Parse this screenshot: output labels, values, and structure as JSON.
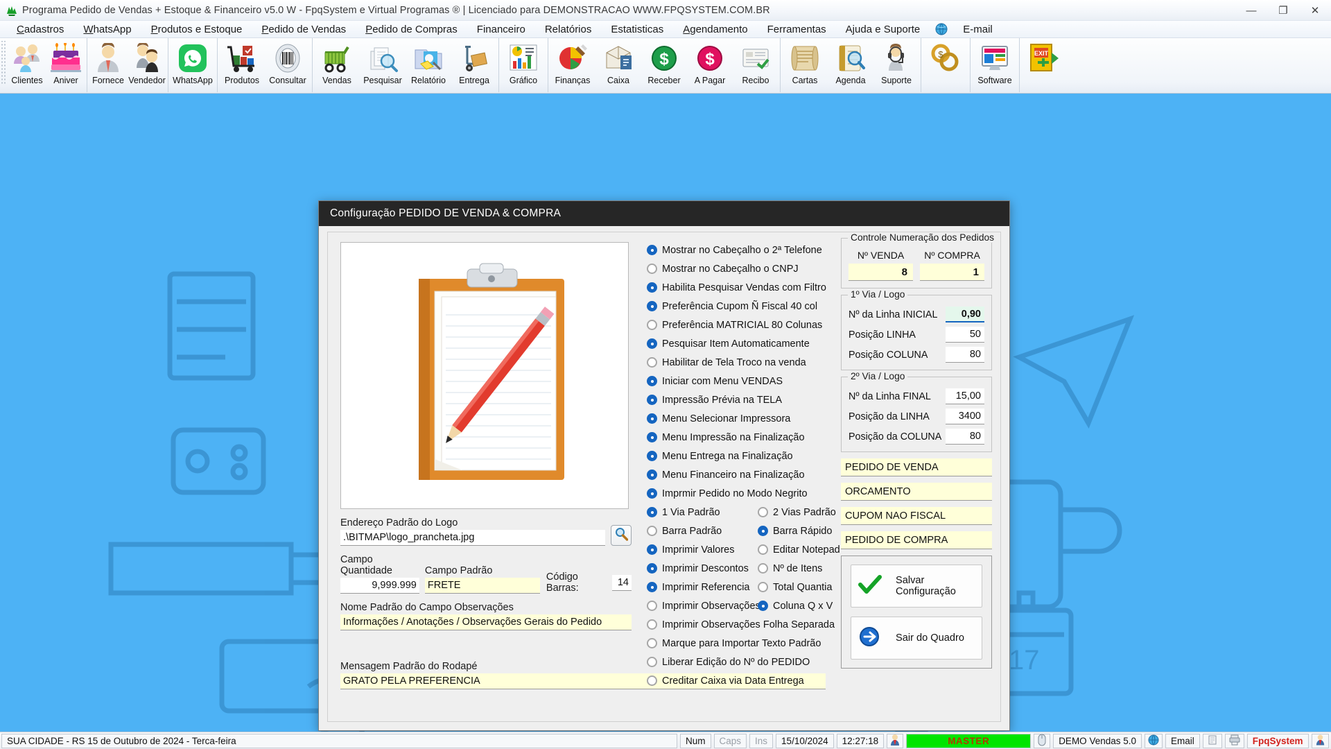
{
  "window": {
    "title": "Programa Pedido de Vendas + Estoque & Financeiro v5.0 W - FpqSystem e Virtual Programas ® | Licenciado para  DEMONSTRACAO WWW.FPQSYSTEM.COM.BR",
    "minimize": "—",
    "maximize": "❐",
    "close": "✕"
  },
  "menubar": {
    "items": [
      {
        "label": "Cadastros"
      },
      {
        "label": "WhatsApp"
      },
      {
        "label": "Produtos e Estoque"
      },
      {
        "label": "Pedido de Vendas"
      },
      {
        "label": "Pedido de Compras"
      },
      {
        "label": "Financeiro"
      },
      {
        "label": "Relatórios"
      },
      {
        "label": "Estatisticas"
      },
      {
        "label": "Agendamento"
      },
      {
        "label": "Ferramentas"
      },
      {
        "label": "Ajuda e Suporte"
      },
      {
        "label": "E-mail"
      }
    ]
  },
  "toolbar": {
    "groups": [
      {
        "buttons": [
          {
            "label": "Clientes",
            "icon": "clients-icon"
          },
          {
            "label": "Aniver",
            "icon": "birthday-cake-icon"
          }
        ]
      },
      {
        "buttons": [
          {
            "label": "Fornece",
            "icon": "supplier-icon"
          },
          {
            "label": "Vendedor",
            "icon": "salesperson-icon"
          }
        ]
      },
      {
        "buttons": [
          {
            "label": "WhatsApp",
            "icon": "whatsapp-icon"
          }
        ]
      },
      {
        "buttons": [
          {
            "label": "Produtos",
            "icon": "products-cart-icon"
          },
          {
            "label": "Consultar",
            "icon": "barcode-icon"
          }
        ]
      },
      {
        "buttons": [
          {
            "label": "Vendas",
            "icon": "shopping-cart-icon"
          },
          {
            "label": "Pesquisar",
            "icon": "search-docs-icon"
          },
          {
            "label": "Relatório",
            "icon": "report-folder-icon"
          },
          {
            "label": "Entrega",
            "icon": "delivery-icon"
          }
        ]
      },
      {
        "buttons": [
          {
            "label": "Gráfico",
            "icon": "chart-icon"
          }
        ]
      },
      {
        "buttons": [
          {
            "label": "Finanças",
            "icon": "finance-icon"
          },
          {
            "label": "Caixa",
            "icon": "cashbox-icon"
          },
          {
            "label": "Receber",
            "icon": "receive-money-icon"
          },
          {
            "label": "A Pagar",
            "icon": "pay-money-icon"
          },
          {
            "label": "Recibo",
            "icon": "receipt-icon"
          }
        ]
      },
      {
        "buttons": [
          {
            "label": "Cartas",
            "icon": "letters-scroll-icon"
          },
          {
            "label": "Agenda",
            "icon": "agenda-icon"
          },
          {
            "label": "Suporte",
            "icon": "support-icon"
          }
        ]
      },
      {
        "buttons": [
          {
            "label": "",
            "icon": "money-rings-icon"
          }
        ]
      },
      {
        "buttons": [
          {
            "label": "Software",
            "icon": "software-icon"
          }
        ]
      },
      {
        "buttons": [
          {
            "label": "",
            "icon": "exit-door-icon"
          }
        ]
      }
    ]
  },
  "dialog": {
    "title": "Configuração PEDIDO DE VENDA & COMPRA",
    "logo_preview_alt": "clipboard-pencil-preview",
    "fields": {
      "logo_address_label": "Endereço Padrão do Logo",
      "logo_address_value": ".\\BITMAP\\logo_prancheta.jpg",
      "search_button_icon": "magnifier-icon",
      "campo_quantidade_label": "Campo Quantidade",
      "campo_quantidade_value": "9,999.999",
      "campo_padrao_label": "Campo Padrão",
      "campo_padrao_value": "FRETE",
      "codigo_barras_label": "Código Barras:",
      "codigo_barras_value": "14",
      "obs_name_label": "Nome Padrão do Campo Observações",
      "obs_name_value": "Informações / Anotações / Observações Gerais do Pedido",
      "rodape_label": "Mensagem Padrão do Rodapé",
      "rodape_value": "GRATO PELA PREFERENCIA"
    },
    "options": [
      {
        "label": "Mostrar no Cabeçalho o 2ª  Telefone",
        "checked": true
      },
      {
        "label": "Mostrar no Cabeçalho o CNPJ",
        "checked": false
      },
      {
        "label": "Habilita Pesquisar Vendas com Filtro",
        "checked": true
      },
      {
        "label": "Preferência Cupom Ñ Fiscal 40 col",
        "checked": true
      },
      {
        "label": "Preferência MATRICIAL 80 Colunas",
        "checked": false
      },
      {
        "label": "Pesquisar Item Automaticamente",
        "checked": true
      },
      {
        "label": "Habilitar de Tela Troco na venda",
        "checked": false
      },
      {
        "label": "Iniciar com Menu VENDAS",
        "checked": true
      },
      {
        "label": "Impressão Prévia na TELA",
        "checked": true
      },
      {
        "label": "Menu Selecionar Impressora",
        "checked": true
      },
      {
        "label": "Menu Impressão na Finalização",
        "checked": true
      },
      {
        "label": "Menu Entrega na Finalização",
        "checked": true
      },
      {
        "label": "Menu Financeiro na Finalização",
        "checked": true
      },
      {
        "label": "Imprmir Pedido no Modo Negrito",
        "checked": true
      }
    ],
    "option_pairs": [
      {
        "left": {
          "label": "1 Via Padrão",
          "checked": true
        },
        "right": {
          "label": "2 Vias Padrão",
          "checked": false
        }
      },
      {
        "left": {
          "label": "Barra Padrão",
          "checked": false
        },
        "right": {
          "label": "Barra Rápido",
          "checked": true
        }
      },
      {
        "left": {
          "label": "Imprimir Valores",
          "checked": true
        },
        "right": {
          "label": "Editar Notepad",
          "checked": false
        }
      },
      {
        "left": {
          "label": "Imprimir Descontos",
          "checked": true
        },
        "right": {
          "label": "Nº de Itens",
          "checked": false
        }
      },
      {
        "left": {
          "label": "Imprimir Referencia",
          "checked": true
        },
        "right": {
          "label": "Total Quantia",
          "checked": false
        }
      },
      {
        "left": {
          "label": "Imprimir Observações",
          "checked": false
        },
        "right": {
          "label": "Coluna Q x V",
          "checked": true
        }
      }
    ],
    "options_tail": [
      {
        "label": "Imprimir Observações Folha Separada",
        "checked": false
      },
      {
        "label": "Marque para Importar Texto Padrão",
        "checked": false
      },
      {
        "label": "Liberar Edição do Nº do PEDIDO",
        "checked": false
      },
      {
        "label": "Creditar Caixa via Data Entrega",
        "checked": false
      }
    ],
    "numbering": {
      "caption": "Controle Numeração dos Pedidos",
      "venda_label": "Nº VENDA",
      "venda_value": "8",
      "compra_label": "Nº COMPRA",
      "compra_value": "1"
    },
    "via1": {
      "caption": "1º Via / Logo",
      "rows": [
        {
          "label": "Nº da Linha INICIAL",
          "value": "0,90",
          "highlight": true
        },
        {
          "label": "Posição LINHA",
          "value": "50",
          "highlight": false
        },
        {
          "label": "Posição COLUNA",
          "value": "80",
          "highlight": false
        }
      ]
    },
    "via2": {
      "caption": "2º Via / Logo",
      "rows": [
        {
          "label": "Nº da Linha FINAL",
          "value": "15,00",
          "highlight": false
        },
        {
          "label": "Posição da LINHA",
          "value": "3400",
          "highlight": false
        },
        {
          "label": "Posição da COLUNA",
          "value": "80",
          "highlight": false
        }
      ]
    },
    "doc_names": [
      "PEDIDO DE VENDA",
      "ORCAMENTO",
      "CUPOM NAO FISCAL",
      "PEDIDO DE COMPRA"
    ],
    "actions": [
      {
        "label": "Salvar Configuração",
        "icon": "green-check-icon"
      },
      {
        "label": "Sair do Quadro",
        "icon": "blue-arrow-right-icon"
      }
    ]
  },
  "statusbar": {
    "location": "SUA CIDADE - RS 15 de Outubro de 2024 - Terca-feira",
    "num": "Num",
    "caps": "Caps",
    "ins": "Ins",
    "date": "15/10/2024",
    "time": "12:27:18",
    "master": "MASTER",
    "demo": "DEMO Vendas 5.0",
    "email": "Email",
    "brand": "FpqSystem"
  },
  "colors": {
    "accent": "#1565c0",
    "dialog_title_bg": "#262626",
    "field_yellow": "#ffffd9",
    "master_green": "#00e500",
    "desktop_blue": "#4db2f5"
  }
}
